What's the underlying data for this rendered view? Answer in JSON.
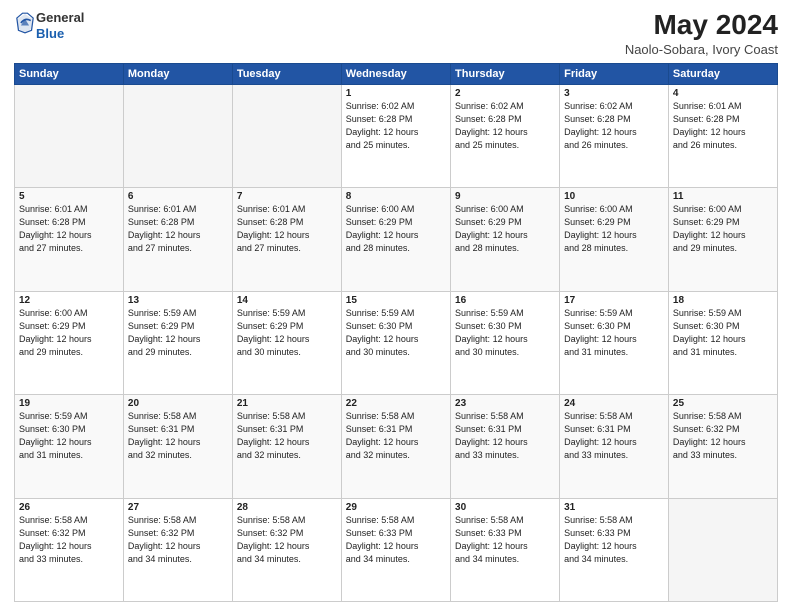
{
  "header": {
    "logo_line1": "General",
    "logo_line2": "Blue",
    "title": "May 2024",
    "subtitle": "Naolo-Sobara, Ivory Coast"
  },
  "weekdays": [
    "Sunday",
    "Monday",
    "Tuesday",
    "Wednesday",
    "Thursday",
    "Friday",
    "Saturday"
  ],
  "weeks": [
    [
      {
        "day": "",
        "info": "",
        "empty": true
      },
      {
        "day": "",
        "info": "",
        "empty": true
      },
      {
        "day": "",
        "info": "",
        "empty": true
      },
      {
        "day": "1",
        "info": "Sunrise: 6:02 AM\nSunset: 6:28 PM\nDaylight: 12 hours\nand 25 minutes.",
        "empty": false
      },
      {
        "day": "2",
        "info": "Sunrise: 6:02 AM\nSunset: 6:28 PM\nDaylight: 12 hours\nand 25 minutes.",
        "empty": false
      },
      {
        "day": "3",
        "info": "Sunrise: 6:02 AM\nSunset: 6:28 PM\nDaylight: 12 hours\nand 26 minutes.",
        "empty": false
      },
      {
        "day": "4",
        "info": "Sunrise: 6:01 AM\nSunset: 6:28 PM\nDaylight: 12 hours\nand 26 minutes.",
        "empty": false
      }
    ],
    [
      {
        "day": "5",
        "info": "Sunrise: 6:01 AM\nSunset: 6:28 PM\nDaylight: 12 hours\nand 27 minutes.",
        "empty": false
      },
      {
        "day": "6",
        "info": "Sunrise: 6:01 AM\nSunset: 6:28 PM\nDaylight: 12 hours\nand 27 minutes.",
        "empty": false
      },
      {
        "day": "7",
        "info": "Sunrise: 6:01 AM\nSunset: 6:28 PM\nDaylight: 12 hours\nand 27 minutes.",
        "empty": false
      },
      {
        "day": "8",
        "info": "Sunrise: 6:00 AM\nSunset: 6:29 PM\nDaylight: 12 hours\nand 28 minutes.",
        "empty": false
      },
      {
        "day": "9",
        "info": "Sunrise: 6:00 AM\nSunset: 6:29 PM\nDaylight: 12 hours\nand 28 minutes.",
        "empty": false
      },
      {
        "day": "10",
        "info": "Sunrise: 6:00 AM\nSunset: 6:29 PM\nDaylight: 12 hours\nand 28 minutes.",
        "empty": false
      },
      {
        "day": "11",
        "info": "Sunrise: 6:00 AM\nSunset: 6:29 PM\nDaylight: 12 hours\nand 29 minutes.",
        "empty": false
      }
    ],
    [
      {
        "day": "12",
        "info": "Sunrise: 6:00 AM\nSunset: 6:29 PM\nDaylight: 12 hours\nand 29 minutes.",
        "empty": false
      },
      {
        "day": "13",
        "info": "Sunrise: 5:59 AM\nSunset: 6:29 PM\nDaylight: 12 hours\nand 29 minutes.",
        "empty": false
      },
      {
        "day": "14",
        "info": "Sunrise: 5:59 AM\nSunset: 6:29 PM\nDaylight: 12 hours\nand 30 minutes.",
        "empty": false
      },
      {
        "day": "15",
        "info": "Sunrise: 5:59 AM\nSunset: 6:30 PM\nDaylight: 12 hours\nand 30 minutes.",
        "empty": false
      },
      {
        "day": "16",
        "info": "Sunrise: 5:59 AM\nSunset: 6:30 PM\nDaylight: 12 hours\nand 30 minutes.",
        "empty": false
      },
      {
        "day": "17",
        "info": "Sunrise: 5:59 AM\nSunset: 6:30 PM\nDaylight: 12 hours\nand 31 minutes.",
        "empty": false
      },
      {
        "day": "18",
        "info": "Sunrise: 5:59 AM\nSunset: 6:30 PM\nDaylight: 12 hours\nand 31 minutes.",
        "empty": false
      }
    ],
    [
      {
        "day": "19",
        "info": "Sunrise: 5:59 AM\nSunset: 6:30 PM\nDaylight: 12 hours\nand 31 minutes.",
        "empty": false
      },
      {
        "day": "20",
        "info": "Sunrise: 5:58 AM\nSunset: 6:31 PM\nDaylight: 12 hours\nand 32 minutes.",
        "empty": false
      },
      {
        "day": "21",
        "info": "Sunrise: 5:58 AM\nSunset: 6:31 PM\nDaylight: 12 hours\nand 32 minutes.",
        "empty": false
      },
      {
        "day": "22",
        "info": "Sunrise: 5:58 AM\nSunset: 6:31 PM\nDaylight: 12 hours\nand 32 minutes.",
        "empty": false
      },
      {
        "day": "23",
        "info": "Sunrise: 5:58 AM\nSunset: 6:31 PM\nDaylight: 12 hours\nand 33 minutes.",
        "empty": false
      },
      {
        "day": "24",
        "info": "Sunrise: 5:58 AM\nSunset: 6:31 PM\nDaylight: 12 hours\nand 33 minutes.",
        "empty": false
      },
      {
        "day": "25",
        "info": "Sunrise: 5:58 AM\nSunset: 6:32 PM\nDaylight: 12 hours\nand 33 minutes.",
        "empty": false
      }
    ],
    [
      {
        "day": "26",
        "info": "Sunrise: 5:58 AM\nSunset: 6:32 PM\nDaylight: 12 hours\nand 33 minutes.",
        "empty": false
      },
      {
        "day": "27",
        "info": "Sunrise: 5:58 AM\nSunset: 6:32 PM\nDaylight: 12 hours\nand 34 minutes.",
        "empty": false
      },
      {
        "day": "28",
        "info": "Sunrise: 5:58 AM\nSunset: 6:32 PM\nDaylight: 12 hours\nand 34 minutes.",
        "empty": false
      },
      {
        "day": "29",
        "info": "Sunrise: 5:58 AM\nSunset: 6:33 PM\nDaylight: 12 hours\nand 34 minutes.",
        "empty": false
      },
      {
        "day": "30",
        "info": "Sunrise: 5:58 AM\nSunset: 6:33 PM\nDaylight: 12 hours\nand 34 minutes.",
        "empty": false
      },
      {
        "day": "31",
        "info": "Sunrise: 5:58 AM\nSunset: 6:33 PM\nDaylight: 12 hours\nand 34 minutes.",
        "empty": false
      },
      {
        "day": "",
        "info": "",
        "empty": true
      }
    ]
  ]
}
